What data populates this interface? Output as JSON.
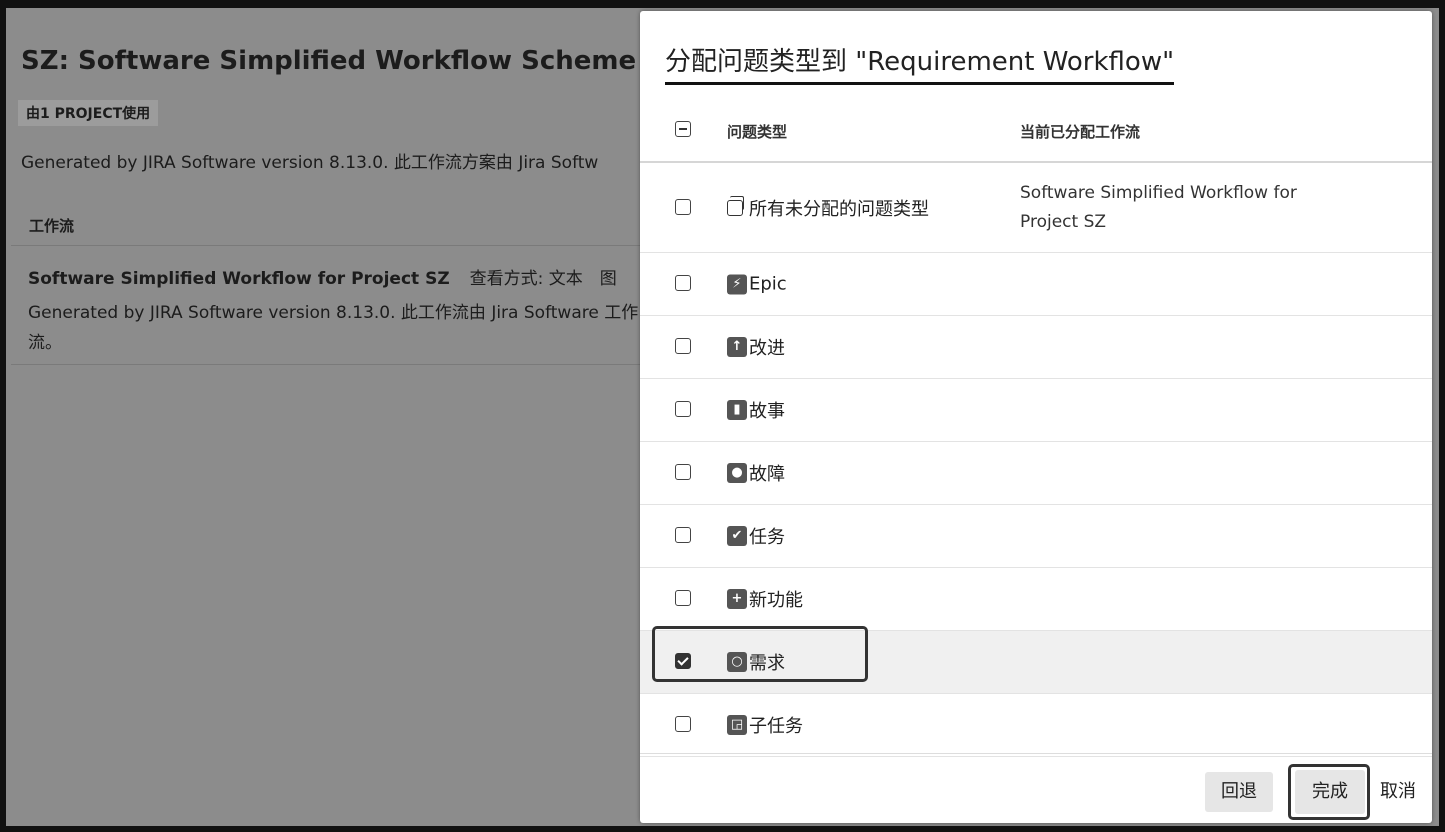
{
  "background": {
    "title": "SZ: Software Simplified Workflow Scheme",
    "badge": "由1 PROJECT使用",
    "description": "Generated by JIRA Software version 8.13.0. 此工作流方案由 Jira Softw",
    "table_header": "工作流",
    "row": {
      "title": "Software Simplified Workflow for Project SZ",
      "view": "查看方式: 文本　图",
      "description": "Generated by JIRA Software version 8.13.0. 此工作流由 Jira Software 工作流。"
    }
  },
  "dialog": {
    "title": "分配问题类型到 \"Requirement Workflow\"",
    "columns": {
      "type": "问题类型",
      "workflow": "当前已分配工作流"
    },
    "rows": [
      {
        "label": "所有未分配的问题类型",
        "icon": "stack-icon",
        "glyph": "",
        "workflow": "Software Simplified Workflow for Project SZ",
        "checked": false
      },
      {
        "label": "Epic",
        "icon": "lightning-icon",
        "glyph": "⚡",
        "workflow": "",
        "checked": false
      },
      {
        "label": "改进",
        "icon": "arrow-up-icon",
        "glyph": "↑",
        "workflow": "",
        "checked": false
      },
      {
        "label": "故事",
        "icon": "bookmark-icon",
        "glyph": "▮",
        "workflow": "",
        "checked": false
      },
      {
        "label": "故障",
        "icon": "bug-dot-icon",
        "glyph": "●",
        "workflow": "",
        "checked": false
      },
      {
        "label": "任务",
        "icon": "checkmark-icon",
        "glyph": "✔",
        "workflow": "",
        "checked": false
      },
      {
        "label": "新功能",
        "icon": "plus-icon",
        "glyph": "+",
        "workflow": "",
        "checked": false
      },
      {
        "label": "需求",
        "icon": "circle-icon",
        "glyph": "○",
        "workflow": "",
        "checked": true
      },
      {
        "label": "子任务",
        "icon": "subtask-icon",
        "glyph": "◲",
        "workflow": "",
        "checked": false
      }
    ],
    "buttons": {
      "back": "回退",
      "done": "完成",
      "cancel": "取消"
    }
  }
}
